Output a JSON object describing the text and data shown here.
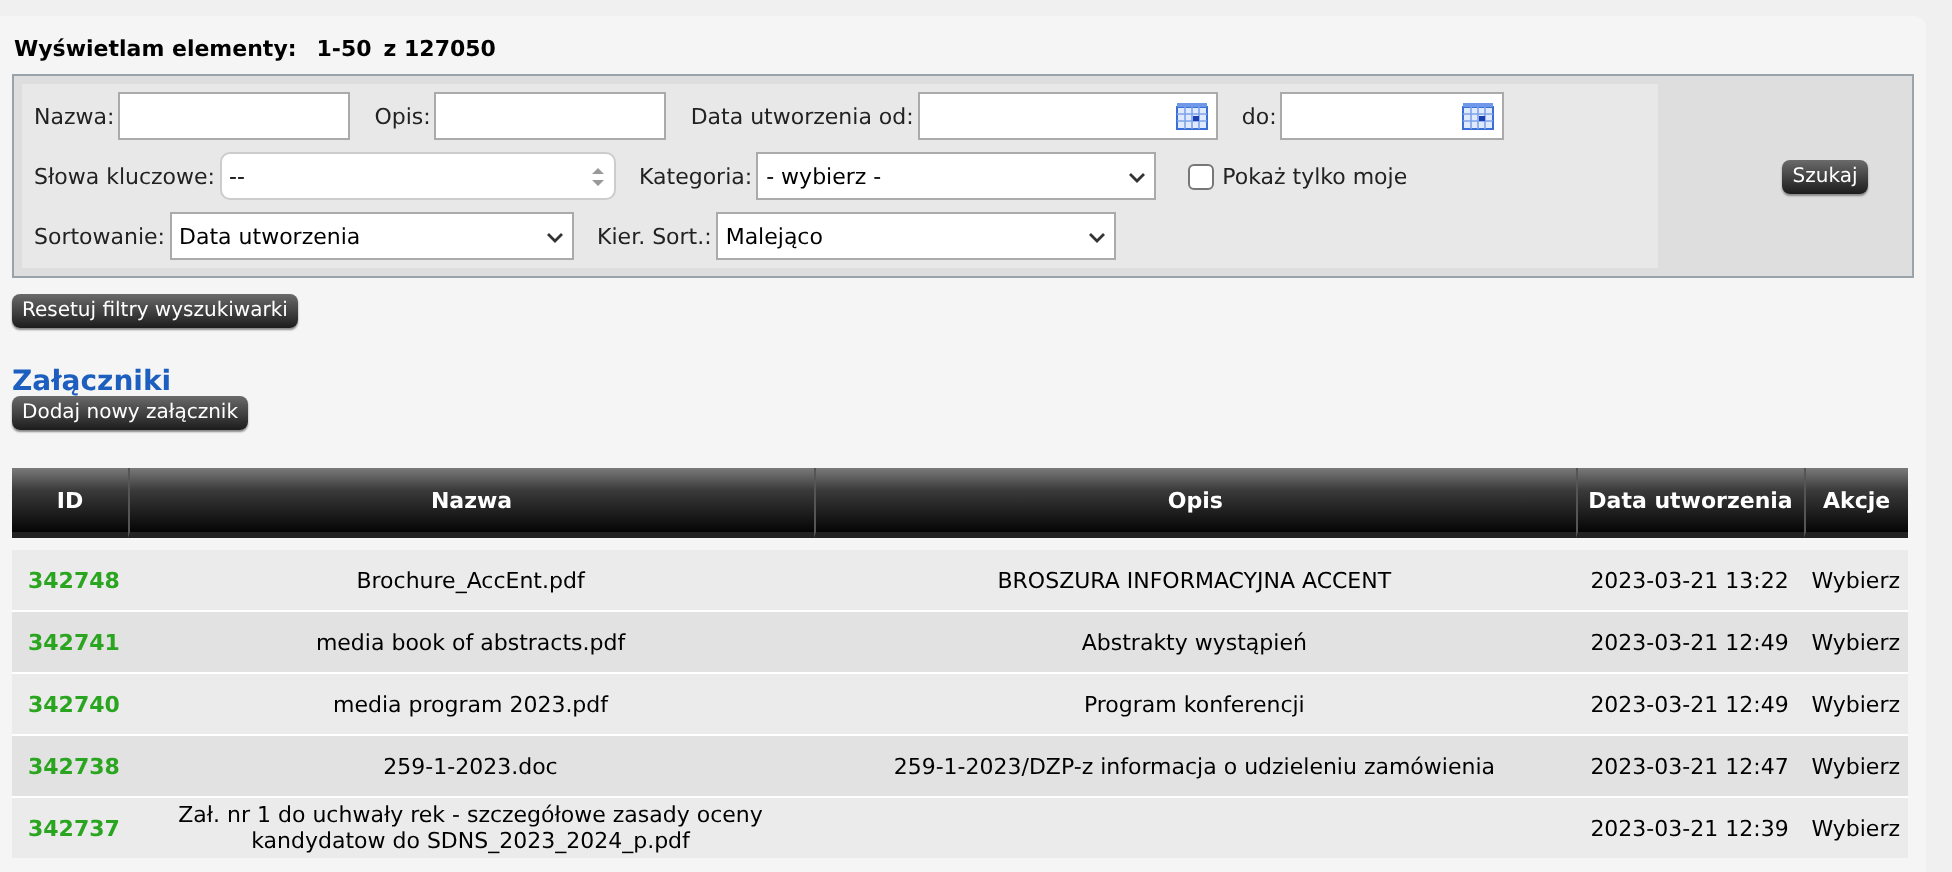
{
  "heading": {
    "label": "Wyświetlam elementy:",
    "range": "1-50",
    "total": "z 127050"
  },
  "filters": [
    [
      {
        "kind": "text",
        "label": "Nazwa:"
      },
      {
        "kind": "text",
        "label": "Opis:"
      },
      {
        "kind": "date",
        "label": "Data utworzenia od:"
      },
      {
        "kind": "date",
        "label": "do:"
      }
    ],
    [
      {
        "kind": "multi",
        "label": "Słowa kluczowe:",
        "value": "--"
      },
      {
        "kind": "select",
        "label": "Kategoria:",
        "value": "- wybierz -"
      },
      {
        "kind": "checkbox",
        "label": "Pokaż tylko moje",
        "checked": false
      }
    ],
    [
      {
        "kind": "select",
        "label": "Sortowanie:",
        "value": "Data utworzenia"
      },
      {
        "kind": "select",
        "label": "Kier. Sort.:",
        "value": "Malejąco"
      }
    ]
  ],
  "search_button": "Szukaj",
  "reset_button": "Resetuj filtry wyszukiwarki",
  "section_title": "Załączniki",
  "add_button": "Dodaj nowy załącznik",
  "table": {
    "columns": [
      "ID",
      "Nazwa",
      "Opis",
      "Data utworzenia",
      "Akcje"
    ],
    "rows": [
      {
        "id": "342748",
        "name": "Brochure_AccEnt.pdf",
        "description": "BROSZURA INFORMACYJNA ACCENT",
        "created": "2023-03-21 13:22",
        "action": "Wybierz"
      },
      {
        "id": "342741",
        "name": "media book of abstracts.pdf",
        "description": "Abstrakty wystąpień",
        "created": "2023-03-21 12:49",
        "action": "Wybierz"
      },
      {
        "id": "342740",
        "name": "media program 2023.pdf",
        "description": "Program konferencji",
        "created": "2023-03-21 12:49",
        "action": "Wybierz"
      },
      {
        "id": "342738",
        "name": "259-1-2023.doc",
        "description": "259-1-2023/DZP-z informacja o udzieleniu zamówienia",
        "created": "2023-03-21 12:47",
        "action": "Wybierz"
      },
      {
        "id": "342737",
        "name": "Zał. nr 1 do uchwały rek - szczegółowe zasady oceny kandydatow do SDNS_2023_2024_p.pdf",
        "created": "2023-03-21 12:39",
        "action": "Wybierz"
      }
    ]
  }
}
